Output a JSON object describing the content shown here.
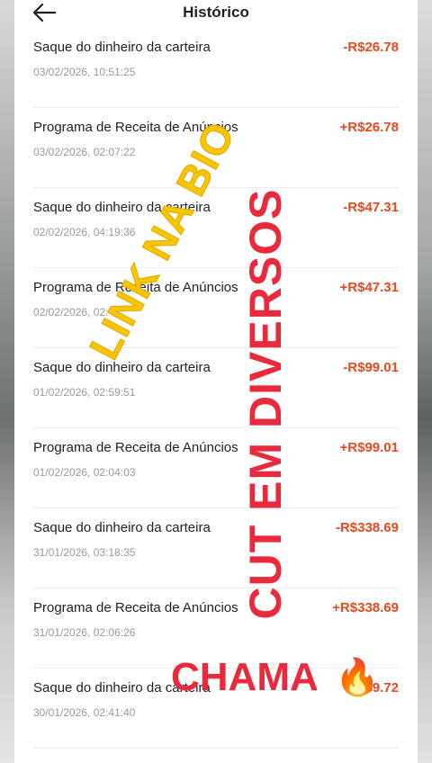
{
  "header": {
    "title": "Histórico"
  },
  "transactions": [
    {
      "label": "Saque do dinheiro da carteira",
      "date": "03/02/2026, 10:51:25",
      "amount": "-R$26.78"
    },
    {
      "label": "Programa de Receita de Anúncios",
      "date": "03/02/2026, 02:07:22",
      "amount": "+R$26.78"
    },
    {
      "label": "Saque do dinheiro da carteira",
      "date": "02/02/2026, 04:19:36",
      "amount": "-R$47.31"
    },
    {
      "label": "Programa de Receita de Anúncios",
      "date": "02/02/2026, 02:",
      "amount": "+R$47.31"
    },
    {
      "label": "Saque do dinheiro da carteira",
      "date": "01/02/2026, 02:59:51",
      "amount": "-R$99.01"
    },
    {
      "label": "Programa de Receita de Anúncios",
      "date": "01/02/2026, 02:04:03",
      "amount": "+R$99.01"
    },
    {
      "label": "Saque do dinheiro da carteira",
      "date": "31/01/2026, 03:18:35",
      "amount": "-R$338.69"
    },
    {
      "label": "Programa de Receita de Anúncios",
      "date": "31/01/2026, 02:06:26",
      "amount": "+R$338.69"
    },
    {
      "label": "Saque do dinheiro da carteira",
      "date": "30/01/2026, 02:41:40",
      "amount": "-R$9.72"
    }
  ],
  "overlays": {
    "link_text": "LINK NA BIO",
    "cut_text": "CUT EM DIVERSOS",
    "chama_text": "CHAMA",
    "fire_emoji": "🔥"
  },
  "colors": {
    "amount": "#e8491e",
    "overlay_yellow": "#f7c600",
    "overlay_red": "#e82a3c"
  },
  "icons": {
    "back": "arrow-left-icon"
  }
}
